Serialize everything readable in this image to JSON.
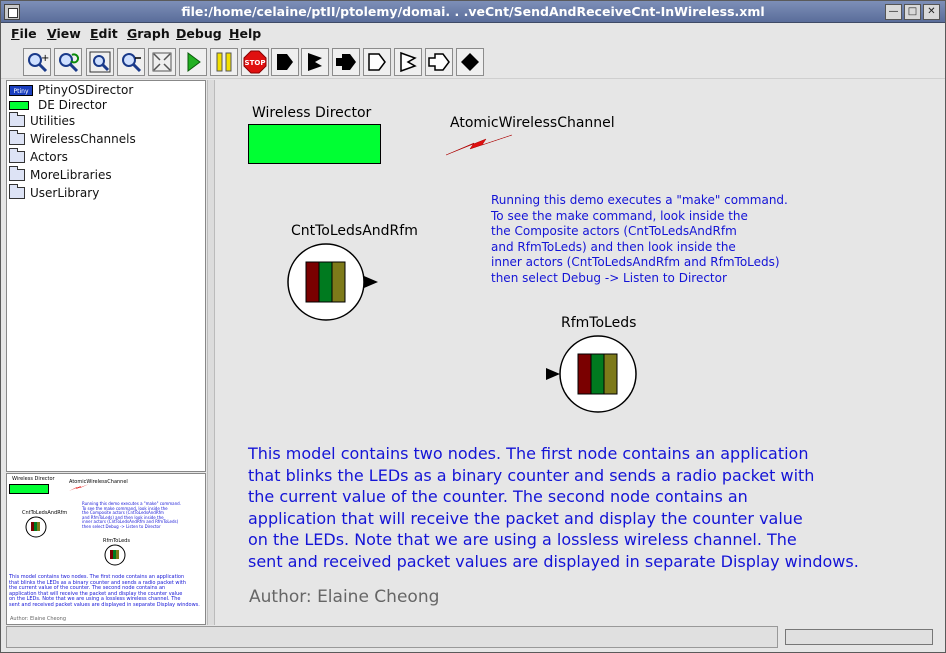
{
  "window": {
    "title": "file:/home/celaine/ptII/ptolemy/domai. . .veCnt/SendAndReceiveCnt-InWireless.xml",
    "minimize_glyph": "—",
    "maximize_glyph": "□",
    "close_glyph": "✕"
  },
  "menu": [
    "File",
    "View",
    "Edit",
    "Graph",
    "Debug",
    "Help"
  ],
  "toolbar": [
    {
      "name": "zoom-in-icon"
    },
    {
      "name": "zoom-reset-icon"
    },
    {
      "name": "zoom-fit-icon"
    },
    {
      "name": "zoom-out-icon"
    },
    {
      "name": "fullscreen-icon"
    },
    {
      "name": "run-icon"
    },
    {
      "name": "pause-icon"
    },
    {
      "name": "stop-icon",
      "label": "STOP"
    },
    {
      "name": "port-input-icon"
    },
    {
      "name": "port-output-icon"
    },
    {
      "name": "port-inout-icon"
    },
    {
      "name": "multiport-input-icon"
    },
    {
      "name": "multiport-output-icon"
    },
    {
      "name": "multiport-inout-icon"
    },
    {
      "name": "relation-icon"
    }
  ],
  "library": {
    "items": [
      {
        "label": "PtinyOSDirector",
        "icon": "ptinyos-director-icon"
      },
      {
        "label": "DE Director",
        "icon": "de-director-icon"
      },
      {
        "label": "Utilities",
        "icon": "folder-icon"
      },
      {
        "label": "WirelessChannels",
        "icon": "folder-icon"
      },
      {
        "label": "Actors",
        "icon": "folder-icon"
      },
      {
        "label": "MoreLibraries",
        "icon": "folder-icon"
      },
      {
        "label": "UserLibrary",
        "icon": "folder-icon"
      }
    ],
    "director_badge": "Ptiny"
  },
  "model": {
    "director_label": "Wireless Director",
    "channel_label": "AtomicWirelessChannel",
    "node1_label": "CntToLedsAndRfm",
    "node2_label": "RfmToLeds",
    "note_lines": [
      "Running this demo executes a \"make\" command.",
      "To see the make command, look inside the",
      "the Composite actors (CntToLedsAndRfm",
      "and RfmToLeds) and then look inside the",
      "inner actors (CntToLedsAndRfm and RfmToLeds)",
      "then select Debug -> Listen to Director"
    ],
    "description_lines": [
      "This model contains two nodes.  The first node contains an application",
      "that blinks the LEDs as a binary counter and sends a radio packet with",
      "the current value of the counter.  The second node contains an",
      "application that will receive the packet and display the counter value",
      "on the LEDs.  Note that we are using a lossless wireless channel.  The",
      "sent and received packet values are displayed in separate Display windows."
    ],
    "author": "Author: Elaine Cheong"
  },
  "colors": {
    "director_green": "#00ff33",
    "text_blue": "#1414d6",
    "author_gray": "#666666",
    "led_red": "#7a0000",
    "led_green": "#007a1f",
    "led_olive": "#7d7a1a",
    "lightning_red": "#e01010"
  },
  "status": {
    "text": ""
  }
}
